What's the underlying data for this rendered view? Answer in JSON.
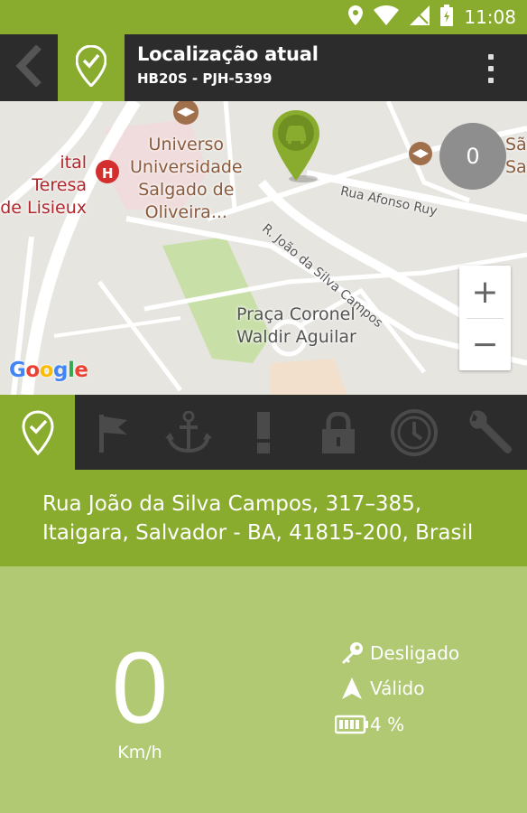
{
  "status_bar": {
    "time": "11:08",
    "icons": [
      "location-icon",
      "wifi-icon",
      "signal-icon",
      "battery-icon"
    ]
  },
  "app_bar": {
    "title": "Localização atual",
    "subtitle": "HB20S - PJH-5399",
    "back_icon": "back-arrow-icon",
    "logo_icon": "location-check-icon",
    "menu_icon": "overflow-menu-icon"
  },
  "map": {
    "poi_university_left": "Universo\nUniversidade\nSalgado de\nOliveira...",
    "poi_hospital": "ital Teresa\nde Lisieux",
    "poi_right": "Sã\nSa",
    "street_1": "R. João da Silva Campos",
    "street_2": "Rua Afonso Ruy",
    "plaza": "Praça Coronel\nWaldir Aguilar",
    "zoom_in": "+",
    "zoom_out": "−",
    "marker_count": "0",
    "google": [
      "G",
      "o",
      "o",
      "g",
      "l",
      "e"
    ],
    "google_colors": [
      "#4285F4",
      "#EA4335",
      "#FBBC05",
      "#4285F4",
      "#34A853",
      "#EA4335"
    ]
  },
  "tabs": [
    {
      "name": "location",
      "icon": "location-check-icon",
      "active": true
    },
    {
      "name": "flag",
      "icon": "flag-icon",
      "active": false
    },
    {
      "name": "anchor",
      "icon": "anchor-icon",
      "active": false
    },
    {
      "name": "alert",
      "icon": "exclamation-icon",
      "active": false
    },
    {
      "name": "lock",
      "icon": "lock-icon",
      "active": false
    },
    {
      "name": "history",
      "icon": "history-icon",
      "active": false
    },
    {
      "name": "settings",
      "icon": "wrench-icon",
      "active": false
    }
  ],
  "address": {
    "line1": "Rua João da Silva Campos, 317–385,",
    "line2": "Itaigara, Salvador - BA, 41815-200, Brasil"
  },
  "stats": {
    "speed": "0",
    "speed_unit": "Km/h",
    "ignition": "Desligado",
    "gps": "Válido",
    "battery": "4 %"
  },
  "colors": {
    "brand_green": "#8aac2e",
    "light_green": "#b0c972",
    "dark_bar": "#2c2c2c"
  }
}
